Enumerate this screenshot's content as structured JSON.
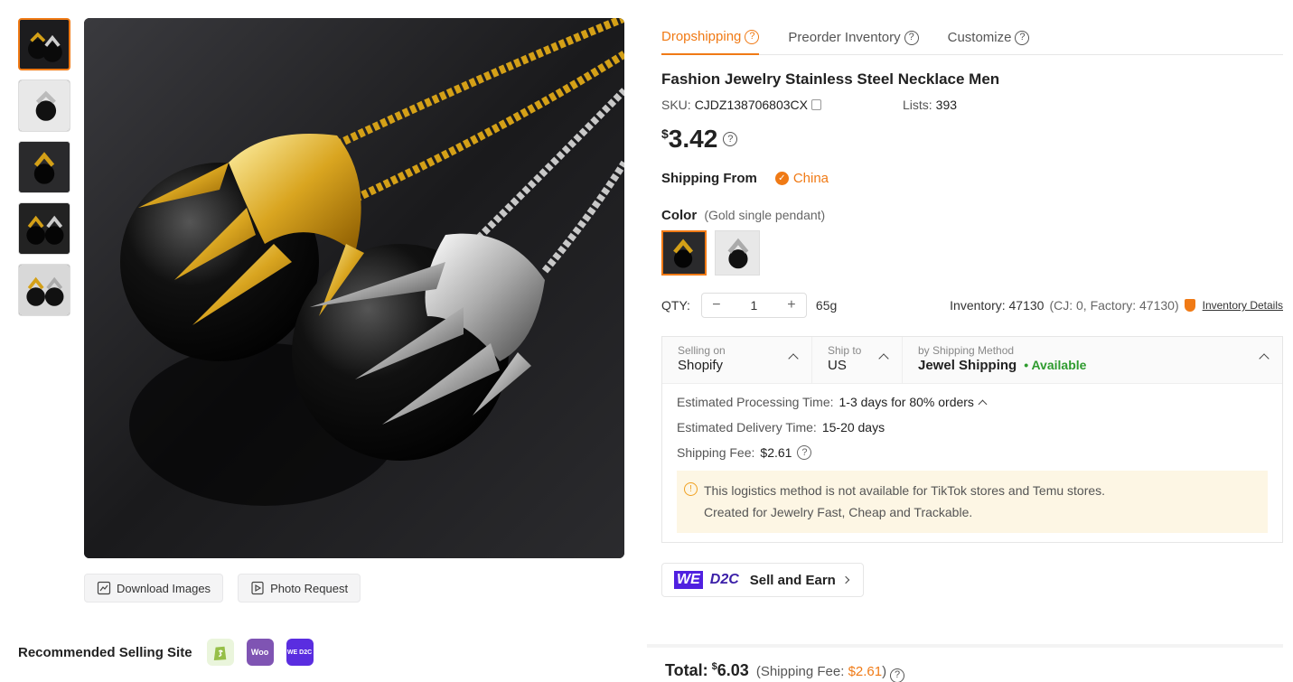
{
  "gallery": {
    "thumbnails": [
      "gold-silver-pair",
      "silver-single",
      "gold-single",
      "pair-dark",
      "pair-side"
    ],
    "actions": {
      "download_label": "Download Images",
      "photo_request_label": "Photo Request"
    }
  },
  "recommend": {
    "title": "Recommended Selling Site",
    "sites": [
      {
        "icon": "shopify-icon",
        "color": "#96bf48"
      },
      {
        "icon": "woo-icon",
        "label": "Woo",
        "color": "#7f54b3"
      },
      {
        "icon": "wed2c-icon",
        "label": "WE D2C",
        "color": "#5a2de0"
      }
    ]
  },
  "tabs": [
    {
      "label": "Dropshipping",
      "active": true
    },
    {
      "label": "Preorder Inventory"
    },
    {
      "label": "Customize"
    }
  ],
  "product": {
    "title": "Fashion Jewelry Stainless Steel Necklace Men",
    "sku_label": "SKU:",
    "sku": "CJDZ138706803CX",
    "lists_label": "Lists:",
    "lists": "393",
    "currency": "$",
    "price": "3.42",
    "shipping_from_label": "Shipping From",
    "shipping_from": "China",
    "color_label": "Color",
    "color_selected": "(Gold single pendant)",
    "qty_label": "QTY:",
    "qty": "1",
    "weight": "65g",
    "inventory": "Inventory: 47130",
    "inventory_breakdown": "(CJ: 0, Factory: 47130)",
    "inventory_link": "Inventory Details"
  },
  "shipping": {
    "selling_on_label": "Selling on",
    "selling_on": "Shopify",
    "ship_to_label": "Ship to",
    "ship_to": "US",
    "method_label": "by Shipping Method",
    "method": "Jewel Shipping",
    "availability": "• Available",
    "processing_label": "Estimated Processing Time:",
    "processing": "1-3 days for 80% orders",
    "delivery_label": "Estimated Delivery Time:",
    "delivery": "15-20 days",
    "fee_label": "Shipping Fee:",
    "fee": "$2.61",
    "notice_line1": "This logistics method is not available for TikTok stores and Temu stores.",
    "notice_line2": "Created for Jewelry Fast, Cheap and Trackable."
  },
  "d2c": {
    "we": "WE",
    "d2c": "D2C",
    "label": "Sell and Earn"
  },
  "total": {
    "label": "Total:",
    "currency": "$",
    "amount": "6.03",
    "fee_prefix": "(Shipping Fee:",
    "fee": "$2.61",
    "fee_suffix": ")"
  },
  "colors": {
    "accent": "#f07a15",
    "available": "#2e9b2e"
  }
}
